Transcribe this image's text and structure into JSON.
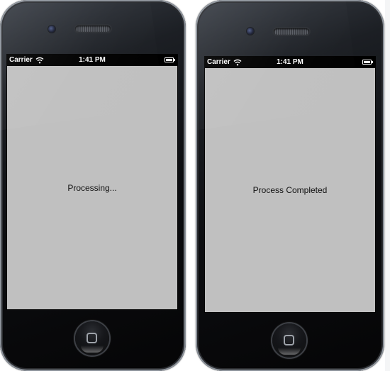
{
  "left_phone": {
    "status_bar": {
      "carrier": "Carrier",
      "time": "1:41 PM",
      "wifi_icon": "wifi-icon",
      "battery_icon": "battery-icon"
    },
    "screen_label": "Processing...",
    "screen_background": "#c0c0c0"
  },
  "right_phone": {
    "status_bar": {
      "carrier": "Carrier",
      "time": "1:41 PM",
      "wifi_icon": "wifi-icon",
      "battery_icon": "battery-icon"
    },
    "screen_label": "Process Completed",
    "screen_background": "#c0c0c0"
  }
}
